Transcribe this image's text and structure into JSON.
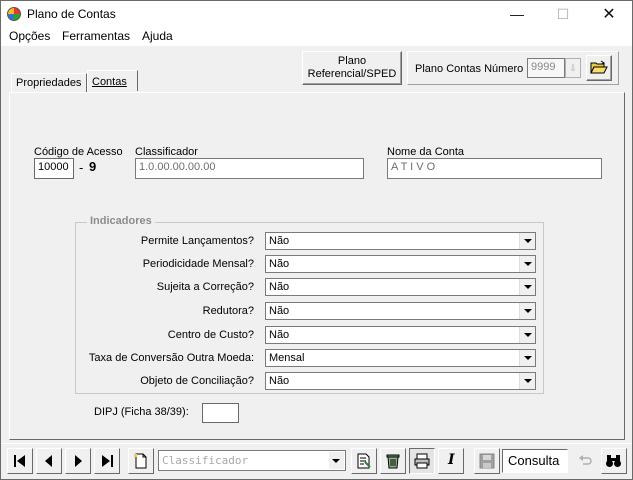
{
  "window": {
    "title": "Plano de Contas"
  },
  "menu": [
    "Opções",
    "Ferramentas",
    "Ajuda"
  ],
  "toolbar": {
    "plano_ref_label_line1": "Plano",
    "plano_ref_label_line2": "Referencial/SPED",
    "plano_numero_label": "Plano Contas Número",
    "plano_numero_value": "9999"
  },
  "tabs": [
    "Propriedades",
    "Contas"
  ],
  "form": {
    "codigo_label": "Código de Acesso",
    "codigo_value": "10000",
    "codigo_dash": "-",
    "codigo_digit": "9",
    "classificador_label": "Classificador",
    "classificador_value": "1.0.00.00.00.00",
    "nome_label": "Nome da Conta",
    "nome_value": "A T I V O"
  },
  "indicadores": {
    "legend": "Indicadores",
    "rows": [
      {
        "label": "Permite Lançamentos?",
        "value": "Não"
      },
      {
        "label": "Periodicidade Mensal?",
        "value": "Não"
      },
      {
        "label": "Sujeita a Correção?",
        "value": "Não"
      },
      {
        "label": "Redutora?",
        "value": "Não"
      },
      {
        "label": "Centro de Custo?",
        "value": "Não"
      },
      {
        "label": "Taxa de Conversão Outra Moeda:",
        "value": "Mensal"
      },
      {
        "label": "Objeto de Conciliação?",
        "value": "Não"
      }
    ]
  },
  "dipj": {
    "label": "DIPJ (Ficha 38/39):",
    "value": ""
  },
  "bottom": {
    "search_placeholder": "Classificador",
    "mode": "Consulta"
  }
}
